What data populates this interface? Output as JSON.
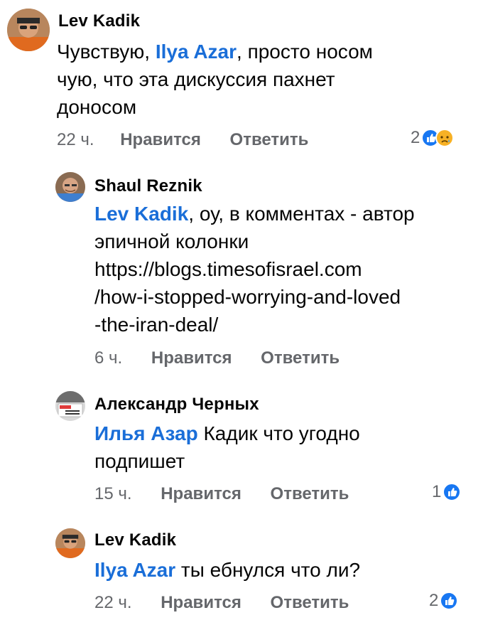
{
  "comments": [
    {
      "author": "Lev Kadik",
      "mention": "Ilya Azar",
      "pre": "Чувствую, ",
      "post": ", просто носом",
      "lines": [
        "чую, что эта дискуссия пахнет",
        "доносом"
      ],
      "time": "22 ч.",
      "like_label": "Нравится",
      "reply_label": "Ответить",
      "reaction_count": "2",
      "reactions": [
        "like-icon",
        "sad-icon"
      ]
    },
    {
      "author": "Shaul Reznik",
      "mention": "Lev Kadik",
      "post": ", оу, в комментах - автор",
      "lines": [
        "эпичной колонки",
        "https://blogs.timesofisrael.com",
        "/how-i-stopped-worrying-and-loved",
        "-the-iran-deal/"
      ],
      "time": "6 ч.",
      "like_label": "Нравится",
      "reply_label": "Ответить"
    },
    {
      "author": "Александр Черных",
      "mention": "Илья Азар",
      "post": " Кадик что угодно",
      "lines": [
        "подпишет"
      ],
      "time": "15 ч.",
      "like_label": "Нравится",
      "reply_label": "Ответить",
      "reaction_count": "1",
      "reactions": [
        "like-icon"
      ]
    },
    {
      "author": "Lev Kadik",
      "mention": "Ilya Azar",
      "post": " ты ебнулся что ли?",
      "time": "22 ч.",
      "like_label": "Нравится",
      "reply_label": "Ответить",
      "reaction_count": "2",
      "reactions": [
        "like-icon"
      ]
    }
  ],
  "colors": {
    "mention": "#1a6ed8",
    "meta": "#65676b",
    "like": "#1877f2",
    "sad": "#f7b125"
  }
}
